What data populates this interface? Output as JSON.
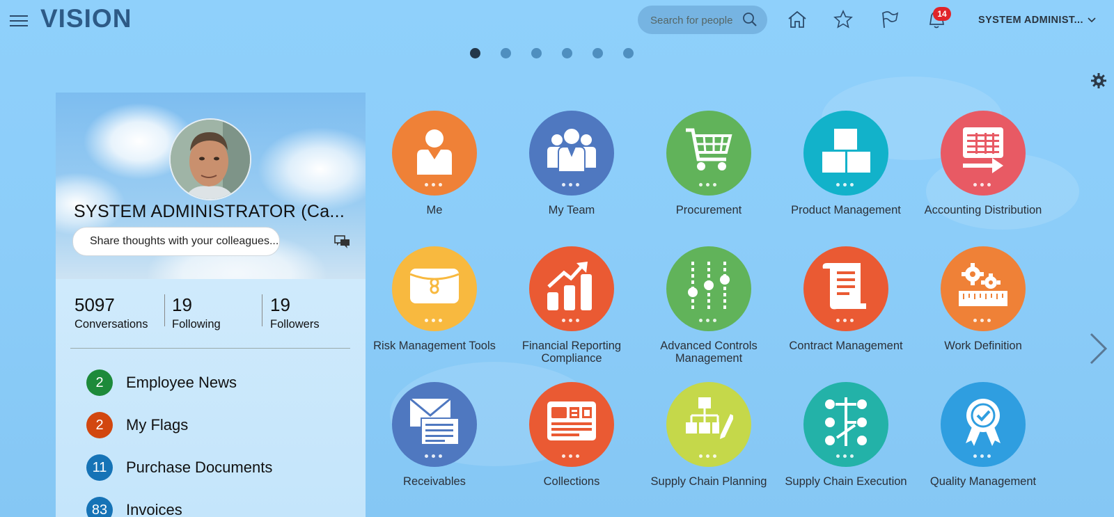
{
  "header": {
    "logo": "VISION",
    "search_placeholder": "Search for people",
    "notification_count": "14",
    "user_name": "SYSTEM ADMINIST..."
  },
  "page_indicator": {
    "count": 6,
    "active_index": 0
  },
  "profile": {
    "name": "SYSTEM ADMINISTRATOR (Ca...",
    "share_placeholder": "Share thoughts with your colleagues...",
    "stats": [
      {
        "value": "5097",
        "label": "Conversations"
      },
      {
        "value": "19",
        "label": "Following"
      },
      {
        "value": "19",
        "label": "Followers"
      }
    ],
    "items": [
      {
        "count": "2",
        "label": "Employee News",
        "color": "#1d8a3a"
      },
      {
        "count": "2",
        "label": "My Flags",
        "color": "#d2470f"
      },
      {
        "count": "11",
        "label": "Purchase Documents",
        "color": "#1673b6"
      },
      {
        "count": "83",
        "label": "Invoices",
        "color": "#1673b6"
      }
    ]
  },
  "tiles": [
    {
      "label": "Me",
      "color": "#ef8137",
      "icon": "person-icon"
    },
    {
      "label": "My Team",
      "color": "#4f78c0",
      "icon": "team-icon"
    },
    {
      "label": "Procurement",
      "color": "#61b35a",
      "icon": "cart-icon"
    },
    {
      "label": "Product Management",
      "color": "#12b2ca",
      "icon": "boxes-icon"
    },
    {
      "label": "Accounting Distribution",
      "color": "#e85a64",
      "icon": "ledger-arrow-icon"
    },
    {
      "label": "Risk Management Tools",
      "color": "#f8b93f",
      "icon": "briefcase-icon"
    },
    {
      "label": "Financial Reporting Compliance",
      "color": "#ea5a33",
      "icon": "growth-chart-icon"
    },
    {
      "label": "Advanced Controls Management",
      "color": "#61b35a",
      "icon": "sliders-icon"
    },
    {
      "label": "Contract Management",
      "color": "#ea5a33",
      "icon": "scroll-icon"
    },
    {
      "label": "Work Definition",
      "color": "#ef8137",
      "icon": "gears-ruler-icon"
    },
    {
      "label": "Receivables",
      "color": "#4f78c0",
      "icon": "envelope-doc-icon"
    },
    {
      "label": "Collections",
      "color": "#ea5a33",
      "icon": "dashboard-doc-icon"
    },
    {
      "label": "Supply Chain Planning",
      "color": "#c5d84a",
      "icon": "org-pencil-icon"
    },
    {
      "label": "Supply Chain Execution",
      "color": "#23b2a8",
      "icon": "network-icon"
    },
    {
      "label": "Quality Management",
      "color": "#2f9ee0",
      "icon": "award-ribbon-icon"
    }
  ]
}
